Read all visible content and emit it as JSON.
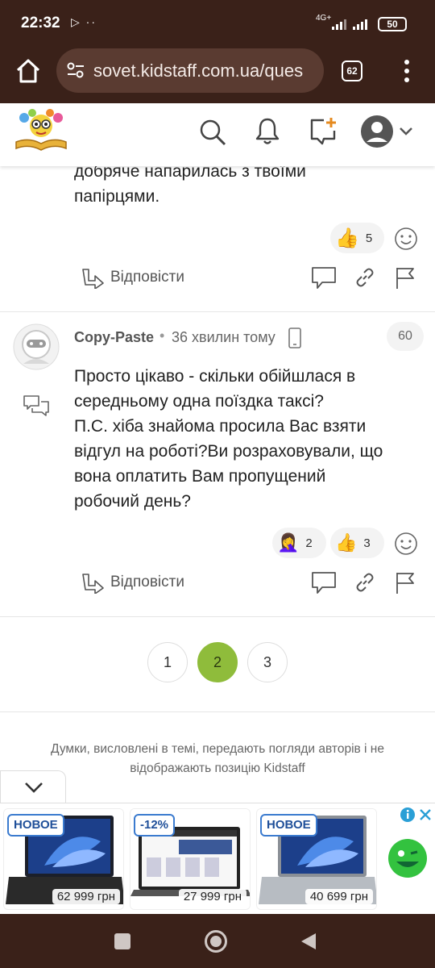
{
  "status_bar": {
    "time": "22:32",
    "extra": "▷ ··",
    "network": "4G+",
    "battery": "50"
  },
  "browser": {
    "url": "sovet.kidstaff.com.ua/ques",
    "tab_count": "62"
  },
  "prev_comment": {
    "text_line1": "добряче напарилась з твоїми",
    "text_line2": "папірцями.",
    "reaction_count": "5",
    "reply_label": "Відповісти"
  },
  "comment": {
    "author": "Copy-Paste",
    "time": "36 хвилин тому",
    "number": "60",
    "text_lines": [
      "Просто цікаво - скільки обійшлася в",
      "середньому одна поїздка таксі?",
      "П.С. хіба знайома просила Вас взяти",
      "відгул на роботі?Ви розраховували, що",
      "вона оплатить Вам пропущений",
      "робочий день?"
    ],
    "reactions": [
      {
        "emoji": "🤦‍♀️",
        "count": "2"
      },
      {
        "emoji": "👍",
        "count": "3"
      }
    ],
    "reply_label": "Відповісти"
  },
  "pagination": {
    "pages": [
      "1",
      "2",
      "3"
    ],
    "active": "2"
  },
  "disclaimer": {
    "line1": "Думки, висловлені в темі, передають погляди авторів і не",
    "line2": "відображають позицію Kidstaff"
  },
  "ad": {
    "items": [
      {
        "badge": "НОВОЕ",
        "price": "62 999 грн"
      },
      {
        "badge": "-12%",
        "price": "27 999 грн"
      },
      {
        "badge": "НОВОЕ",
        "price": "40 699 грн"
      }
    ]
  },
  "colors": {
    "brand_dark": "#3a2119",
    "accent_green": "#8fbc3b",
    "link_blue": "#2f7bd8"
  }
}
